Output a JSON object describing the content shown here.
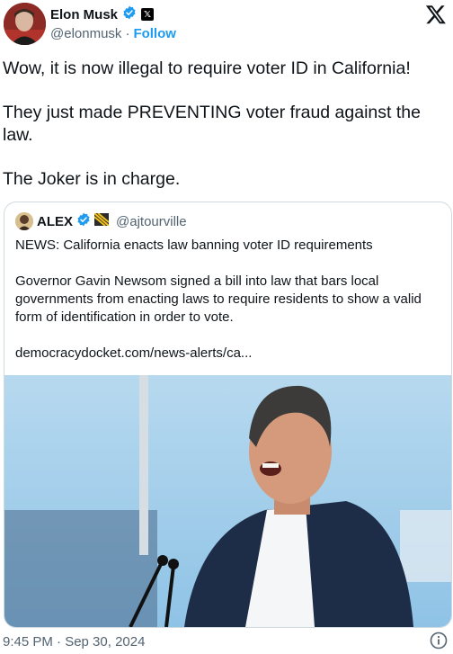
{
  "author": {
    "name": "Elon Musk",
    "handle": "@elonmusk",
    "separator": "·",
    "follow_label": "Follow"
  },
  "tweet": {
    "paragraphs": [
      "Wow, it is now illegal to require voter ID in California!",
      "They just made PREVENTING voter fraud against the law.",
      "The Joker is in charge."
    ]
  },
  "quote": {
    "name": "ALEX",
    "handle": "@ajtourville",
    "headline": "NEWS: California enacts law banning voter ID requirements",
    "description": "Governor Gavin Newsom signed a bill into law that bars local governments from enacting laws to require residents to show a valid form of identification in order to vote.",
    "link": "democracydocket.com/news-alerts/ca..."
  },
  "footer": {
    "timestamp": "9:45 PM · Sep 30, 2024"
  },
  "colors": {
    "accent": "#1d9bf0",
    "secondary_text": "#536471",
    "border": "#cfd9de"
  },
  "icons": [
    "verified-badge-icon",
    "x-affiliate-badge-icon",
    "x-logo-icon",
    "flag-icon",
    "info-icon"
  ]
}
